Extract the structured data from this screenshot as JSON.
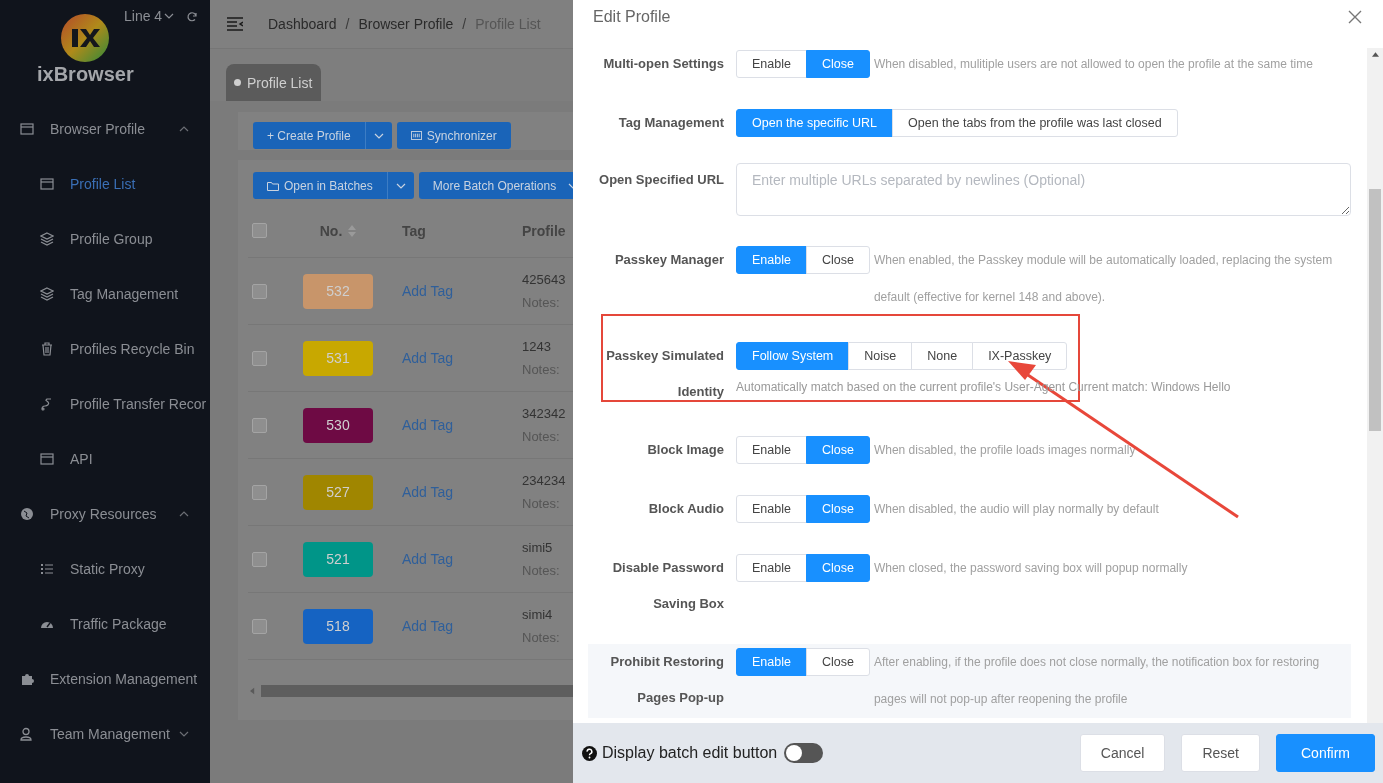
{
  "sidebar": {
    "brand": "ixBrowser",
    "line_selector": "Line 4",
    "items": [
      {
        "label": "Browser Profile",
        "expanded": true,
        "children": [
          {
            "label": "Profile List",
            "selected": true
          },
          {
            "label": "Profile Group",
            "selected": false
          },
          {
            "label": "Tag Management",
            "selected": false
          },
          {
            "label": "Profiles Recycle Bin",
            "selected": false
          },
          {
            "label": "Profile Transfer Recor",
            "selected": false
          },
          {
            "label": "API",
            "selected": false
          }
        ]
      },
      {
        "label": "Proxy Resources",
        "expanded": true,
        "children": [
          {
            "label": "Static Proxy",
            "selected": false
          },
          {
            "label": "Traffic Package",
            "selected": false
          }
        ]
      },
      {
        "label": "Extension Management"
      },
      {
        "label": "Team Management",
        "expanded": false
      }
    ]
  },
  "breadcrumb": [
    {
      "label": "Dashboard"
    },
    {
      "separator": "/",
      "label": "Browser Profile"
    },
    {
      "separator": "/",
      "label": "Profile List"
    }
  ],
  "tabs": [
    {
      "label": "Profile List",
      "selected": true
    }
  ],
  "toolbar": {
    "create_button": "+ Create Profile",
    "synchronizer_button": "Synchronizer",
    "open_batches_button": "Open in Batches",
    "more_button": "More Batch Operations"
  },
  "table": {
    "select_all_checked": false,
    "columns": [
      "No.",
      "Tag",
      "Profile"
    ],
    "rows": [
      {
        "no": "532",
        "color": "#c8956a",
        "tag": "Add Tag",
        "name": "425643",
        "notes": "Notes:",
        "checked": false
      },
      {
        "no": "531",
        "color": "#c8a800",
        "tag": "Add Tag",
        "name": "1243",
        "notes": "Notes:",
        "checked": false
      },
      {
        "no": "530",
        "color": "#6e0a44",
        "tag": "Add Tag",
        "name": "342342",
        "notes": "Notes:",
        "checked": false
      },
      {
        "no": "527",
        "color": "#a08600",
        "tag": "Add Tag",
        "name": "234234",
        "notes": "Notes:",
        "checked": false
      },
      {
        "no": "521",
        "color": "#009588",
        "tag": "Add Tag",
        "name": "simi5",
        "notes": "Notes:",
        "checked": false
      },
      {
        "no": "518",
        "color": "#1563c2",
        "tag": "Add Tag",
        "name": "simi4",
        "notes": "Notes:",
        "checked": false
      }
    ]
  },
  "drawer": {
    "title": "Edit Profile",
    "settings": [
      {
        "kind": "segmented",
        "label": "Multi-open Settings",
        "options": [
          {
            "label": "Enable",
            "selected": false
          },
          {
            "label": "Close",
            "selected": true
          }
        ],
        "hint": "When disabled, mulitiple users are not allowed to open the profile at the same time"
      },
      {
        "kind": "segmented",
        "label": "Tag Management",
        "options": [
          {
            "label": "Open the specific URL",
            "selected": true
          },
          {
            "label": "Open the tabs from the profile was last closed",
            "selected": false
          }
        ]
      },
      {
        "kind": "textarea",
        "label": "Open Specified URL",
        "placeholder": "Enter multiple URLs separated by newlines (Optional)"
      },
      {
        "kind": "segmented",
        "label": "Passkey Manager",
        "options": [
          {
            "label": "Enable",
            "selected": true
          },
          {
            "label": "Close",
            "selected": false
          }
        ],
        "hint": "When enabled, the Passkey module will be automatically loaded, replacing the system default (effective for kernel 148 and above)."
      },
      {
        "kind": "segmented",
        "label": "Passkey Simulated Identity",
        "options": [
          {
            "label": "Follow System",
            "selected": true
          },
          {
            "label": "Noise",
            "selected": false
          },
          {
            "label": "None",
            "selected": false
          },
          {
            "label": "IX-Passkey",
            "selected": false
          }
        ],
        "note": "Automatically match based on the current profile's User-Agent Current match: Windows Hello",
        "annotated": true
      },
      {
        "kind": "segmented",
        "label": "Block Image",
        "options": [
          {
            "label": "Enable",
            "selected": false
          },
          {
            "label": "Close",
            "selected": true
          }
        ],
        "hint": "When disabled, the profile loads images normally"
      },
      {
        "kind": "segmented",
        "label": "Block Audio",
        "options": [
          {
            "label": "Enable",
            "selected": false
          },
          {
            "label": "Close",
            "selected": true
          }
        ],
        "hint": "When disabled, the audio will play normally by default"
      },
      {
        "kind": "segmented",
        "label": "Disable Password Saving Box",
        "options": [
          {
            "label": "Enable",
            "selected": false
          },
          {
            "label": "Close",
            "selected": true
          }
        ],
        "hint": "When closed, the password saving box will popup normally"
      },
      {
        "kind": "segmented",
        "label": "Prohibit Restoring Pages Pop-up",
        "options": [
          {
            "label": "Enable",
            "selected": true
          },
          {
            "label": "Close",
            "selected": false
          }
        ],
        "hint": "After enabling, if the profile does not close normally, the notification box for restoring pages will not pop-up after reopening the profile",
        "highlighted": true
      }
    ],
    "footer": {
      "toggle_label": "Display batch edit button",
      "toggle_on": false,
      "buttons": [
        {
          "label": "Cancel",
          "kind": "plain"
        },
        {
          "label": "Reset",
          "kind": "plain"
        },
        {
          "label": "Confirm",
          "kind": "primary"
        }
      ]
    }
  }
}
